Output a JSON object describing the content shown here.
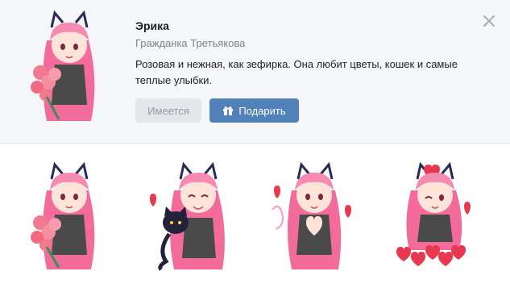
{
  "pack": {
    "name": "Эрика",
    "author": "Гражданка Третьякова",
    "description": "Розовая и нежная, как зефирка. Она любит цветы, кошек и самые теплые улыбки.",
    "owned_label": "Имеется",
    "gift_label": "Подарить"
  },
  "icons": {
    "close": "close-icon",
    "gift": "gift-icon"
  },
  "colors": {
    "accent": "#5181b8",
    "header_bg": "#f5f6f8",
    "owned_bg": "#e4e7ea",
    "owned_text": "#939aa3",
    "hair": "#f26b9a",
    "ears": "#2a2a5a"
  },
  "stickers": [
    {
      "name": "sticker-flowers"
    },
    {
      "name": "sticker-black-cat"
    },
    {
      "name": "sticker-heart-hands"
    },
    {
      "name": "sticker-hearts-pile"
    }
  ]
}
